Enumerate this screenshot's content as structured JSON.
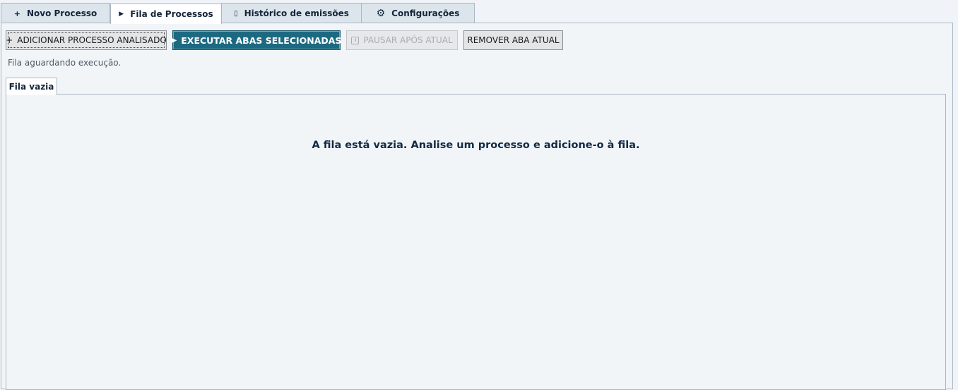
{
  "tabs": [
    {
      "label": "Novo Processo",
      "icon": "plus-icon",
      "icon_glyph": "+"
    },
    {
      "label": "Fila de Processos",
      "icon": "play-icon",
      "icon_glyph": "▶"
    },
    {
      "label": "Histórico de emissões",
      "icon": "document-icon",
      "icon_glyph": "▯"
    },
    {
      "label": "Configurações",
      "icon": "gear-icon",
      "icon_glyph": "⚙"
    }
  ],
  "active_tab": "Fila de Processos",
  "toolbar": {
    "add_icon_glyph": "+",
    "add_label": "ADICIONAR PROCESSO ANALISADO",
    "exec_icon_glyph": "▶",
    "exec_label": "EXECUTAR ABAS SELECIONADAS",
    "pause_icon_glyph": "II",
    "pause_label": "PAUSAR APÓS ATUAL",
    "remove_label": "REMOVER ABA ATUAL"
  },
  "status_text": "Fila aguardando execução.",
  "queue": {
    "tab_label": "Fila vazia",
    "empty_message": "A fila está vazia. Analise um processo e adicione-o à fila."
  },
  "colors": {
    "accent": "#1c6a82",
    "background": "#f0f4f8",
    "text_dark": "#132a45"
  }
}
